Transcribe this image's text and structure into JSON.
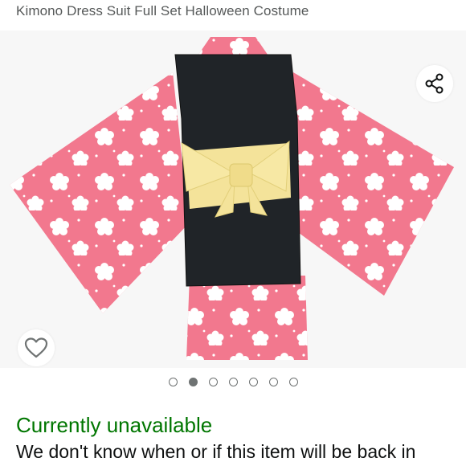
{
  "product": {
    "title": "Kimono Dress Suit Full Set Halloween Costume"
  },
  "gallery": {
    "image_description": "pink kimono with white flower pattern, black vest and yellow bow, back view",
    "total_images": 7,
    "active_index": 1,
    "share_icon": "share-icon",
    "wishlist_icon": "heart-outline-icon"
  },
  "availability": {
    "status": "Currently unavailable",
    "message": "We don't know when or if this item will be back in",
    "status_color": "#007600"
  }
}
